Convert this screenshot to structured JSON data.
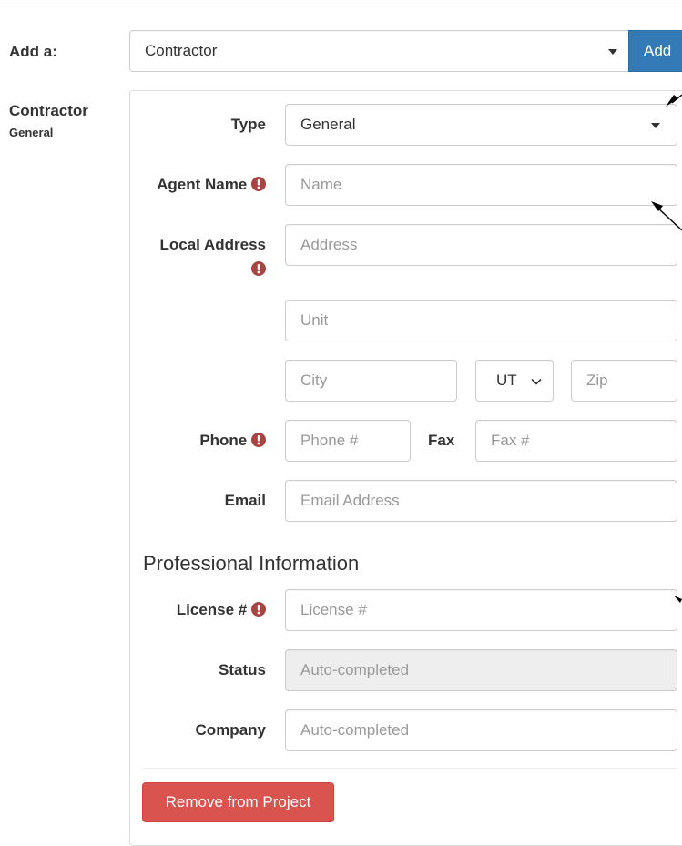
{
  "add_row": {
    "label": "Add a:",
    "selected": "Contractor",
    "button_label": "Add"
  },
  "sidebar": {
    "title": "Contractor",
    "subtitle": "General"
  },
  "form": {
    "type": {
      "label": "Type",
      "value": "General"
    },
    "agent_name": {
      "label": "Agent Name",
      "placeholder": "Name"
    },
    "local_address": {
      "label": "Local Address",
      "address_placeholder": "Address",
      "unit_placeholder": "Unit",
      "city_placeholder": "City",
      "state_value": "UT",
      "zip_placeholder": "Zip"
    },
    "phone": {
      "label": "Phone",
      "placeholder": "Phone #"
    },
    "fax": {
      "label": "Fax",
      "placeholder": "Fax #"
    },
    "email": {
      "label": "Email",
      "placeholder": "Email Address"
    }
  },
  "professional": {
    "title": "Professional Information",
    "license": {
      "label": "License #",
      "placeholder": "License #"
    },
    "status": {
      "label": "Status",
      "value": "Auto-completed"
    },
    "company": {
      "label": "Company",
      "placeholder": "Auto-completed"
    }
  },
  "remove_button": "Remove from Project",
  "icons": {
    "required": "exclamation-circle-icon",
    "dropdown": "caret-down-icon",
    "select_chevron": "chevron-down-icon",
    "annotation": "arrow-icon"
  },
  "colors": {
    "primary": "#337ab7",
    "danger": "#d9534f",
    "required": "#a94442",
    "disabled_bg": "#eeeeee"
  }
}
